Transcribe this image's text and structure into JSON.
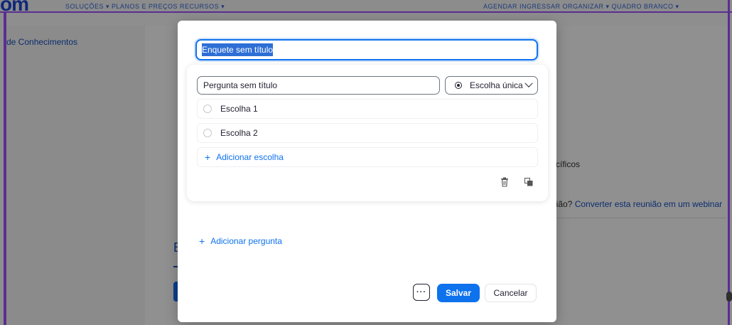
{
  "background": {
    "logo": "om",
    "nav_left": "SOLUÇÕES ▾   PLANOS E PREÇOS   RECURSOS ▾",
    "nav_right": "AGENDAR   INGRESSAR   ORGANIZAR ▾   QUADRO BRANCO ▾",
    "sidebar_link": "de Conhecimentos",
    "text_fragment_1": "cíficos",
    "text_fragment_2_prefix": "nião?",
    "text_fragment_2_link": "Converter esta reunião em um webinar",
    "heading_fragment": "E"
  },
  "modal": {
    "title_value": "Enquete sem título",
    "question": {
      "text": "Pergunta sem título",
      "type_label": "Escolha única",
      "choices": [
        "Escolha 1",
        "Escolha 2"
      ],
      "add_choice_label": "Adicionar escolha"
    },
    "add_question_label": "Adicionar pergunta",
    "footer": {
      "more_label": "···",
      "save_label": "Salvar",
      "cancel_label": "Cancelar"
    }
  },
  "colors": {
    "accent": "#0e72ed",
    "selection": "#2e6fd6",
    "border_frame": "#5a2e91"
  },
  "icons": [
    "trash-icon",
    "copy-icon",
    "plus-icon",
    "chevron-down-icon",
    "radio-icon"
  ]
}
